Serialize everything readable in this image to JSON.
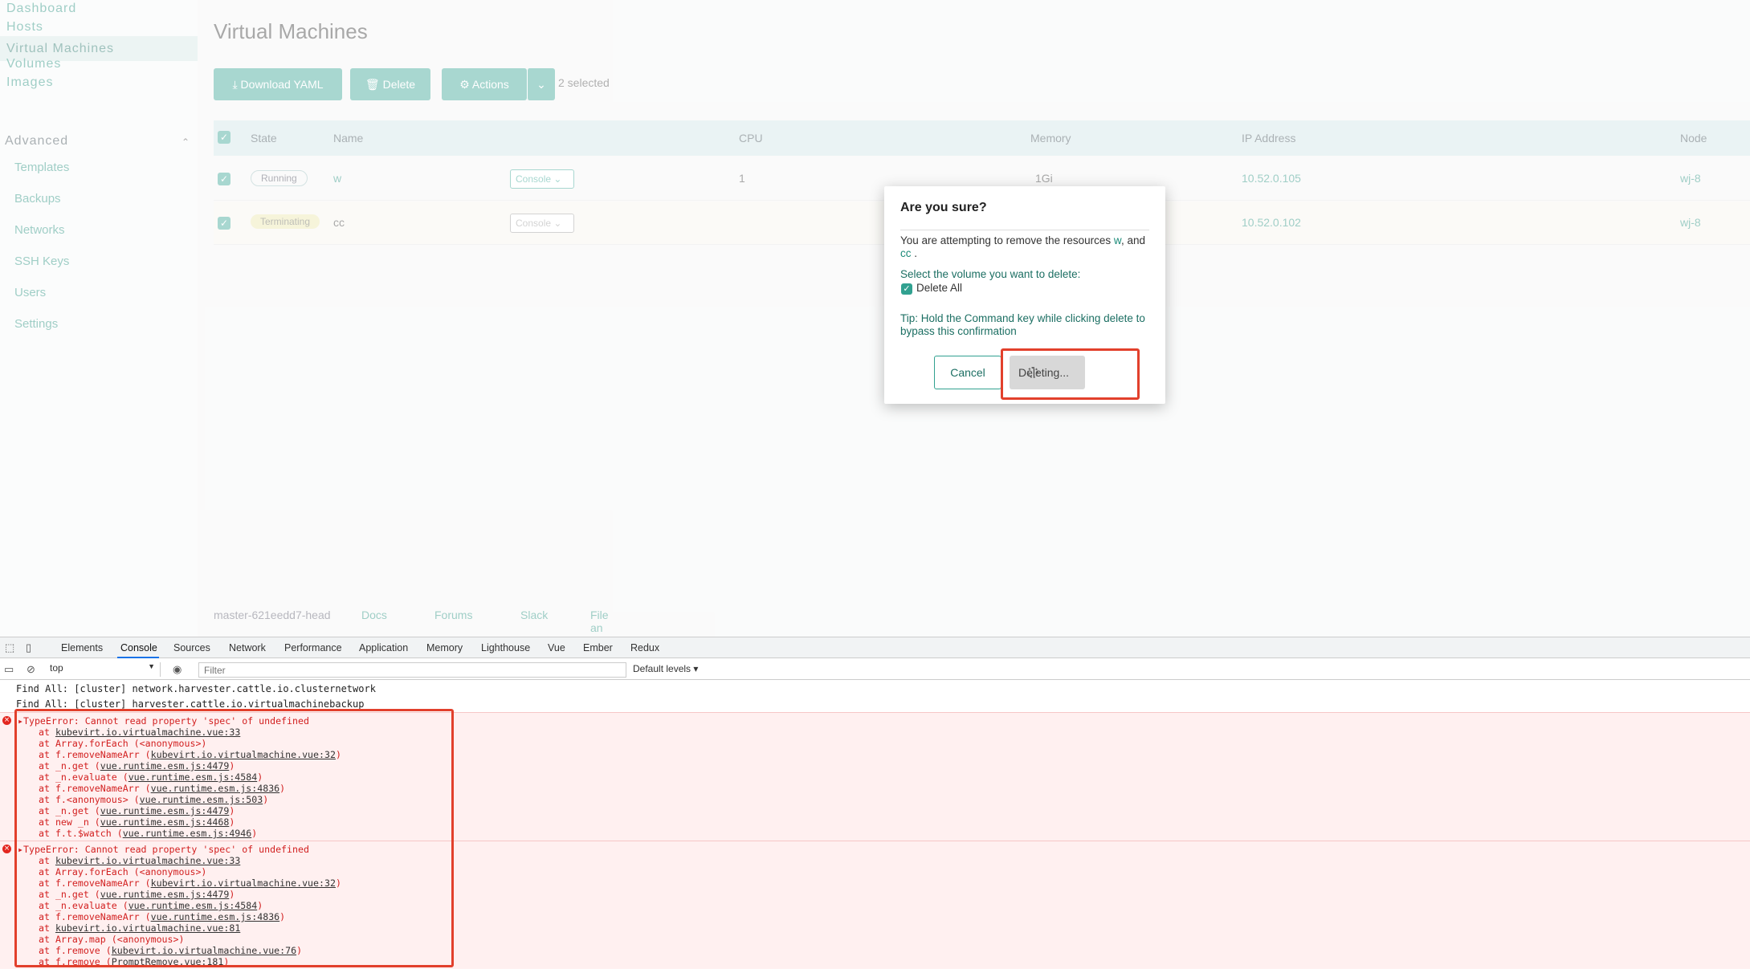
{
  "sidebar": {
    "items": [
      "Dashboard",
      "Hosts",
      "Virtual Machines",
      "Volumes",
      "Images"
    ],
    "advanced_label": "Advanced",
    "advanced_items": [
      "Templates",
      "Backups",
      "Networks",
      "SSH Keys",
      "Users",
      "Settings"
    ]
  },
  "main": {
    "title": "Virtual Machines",
    "buttons": {
      "download": "Download YAML",
      "delete": "Delete",
      "actions": "Actions"
    },
    "selected_text": "2 selected",
    "columns": [
      "State",
      "Name",
      "CPU",
      "Memory",
      "IP Address",
      "Node"
    ],
    "rows": [
      {
        "state": "Running",
        "name": "w",
        "console": "Console",
        "cpu": "1",
        "memory": "1Gi",
        "ip": "10.52.0.105",
        "node": "wj-8"
      },
      {
        "state": "Terminating",
        "name": "cc",
        "console": "Console",
        "cpu": "",
        "memory": "",
        "ip": "10.52.0.102",
        "node": "wj-8"
      }
    ]
  },
  "footer": {
    "version": "master-621eedd7-head",
    "links": [
      "Docs",
      "Forums",
      "Slack",
      "File an Issue"
    ]
  },
  "modal": {
    "title": "Are you sure?",
    "body_prefix": "You are attempting to remove the resources",
    "resource1": "w",
    "body_mid": ", and",
    "resource2": "cc",
    "body_suffix": ".",
    "volume_label": "Select the volume you want to delete:",
    "delete_all_label": "Delete All",
    "tip": "Tip: Hold the Command key while clicking delete to bypass this confirmation",
    "cancel": "Cancel",
    "deleting": "Deleting..."
  },
  "devtools": {
    "tabs": [
      "Elements",
      "Console",
      "Sources",
      "Network",
      "Performance",
      "Application",
      "Memory",
      "Lighthouse",
      "Vue",
      "Ember",
      "Redux"
    ],
    "active_tab": "Console",
    "context": "top",
    "filter_placeholder": "Filter",
    "levels": "Default levels ▾",
    "logs": [
      "Find All: [cluster] network.harvester.cattle.io.clusternetwork",
      "Find All: [cluster] harvester.cattle.io.virtualmachinebackup"
    ],
    "errors": [
      {
        "message": "TypeError: Cannot read property 'spec' of undefined",
        "stack": [
          [
            "at ",
            "kubevirt.io.virtualmachine.vue:33",
            ""
          ],
          [
            "at Array.forEach (<anonymous>)",
            "",
            ""
          ],
          [
            "at f.removeNameArr (",
            "kubevirt.io.virtualmachine.vue:32",
            ")"
          ],
          [
            "at _n.get (",
            "vue.runtime.esm.js:4479",
            ")"
          ],
          [
            "at _n.evaluate (",
            "vue.runtime.esm.js:4584",
            ")"
          ],
          [
            "at f.removeNameArr (",
            "vue.runtime.esm.js:4836",
            ")"
          ],
          [
            "at f.<anonymous> (",
            "vue.runtime.esm.js:503",
            ")"
          ],
          [
            "at _n.get (",
            "vue.runtime.esm.js:4479",
            ")"
          ],
          [
            "at new _n (",
            "vue.runtime.esm.js:4468",
            ")"
          ],
          [
            "at f.t.$watch (",
            "vue.runtime.esm.js:4946",
            ")"
          ]
        ]
      },
      {
        "message": "TypeError: Cannot read property 'spec' of undefined",
        "stack": [
          [
            "at ",
            "kubevirt.io.virtualmachine.vue:33",
            ""
          ],
          [
            "at Array.forEach (<anonymous>)",
            "",
            ""
          ],
          [
            "at f.removeNameArr (",
            "kubevirt.io.virtualmachine.vue:32",
            ")"
          ],
          [
            "at _n.get (",
            "vue.runtime.esm.js:4479",
            ")"
          ],
          [
            "at _n.evaluate (",
            "vue.runtime.esm.js:4584",
            ")"
          ],
          [
            "at f.removeNameArr (",
            "vue.runtime.esm.js:4836",
            ")"
          ],
          [
            "at ",
            "kubevirt.io.virtualmachine.vue:81",
            ""
          ],
          [
            "at Array.map (<anonymous>)",
            "",
            ""
          ],
          [
            "at f.remove (",
            "kubevirt.io.virtualmachine.vue:76",
            ")"
          ],
          [
            "at f.remove (",
            "PromptRemove.vue:181",
            ")"
          ]
        ]
      }
    ]
  },
  "colors": {
    "accent": "#31a190",
    "error": "#d21f1f",
    "highlight": "#e2402c"
  }
}
